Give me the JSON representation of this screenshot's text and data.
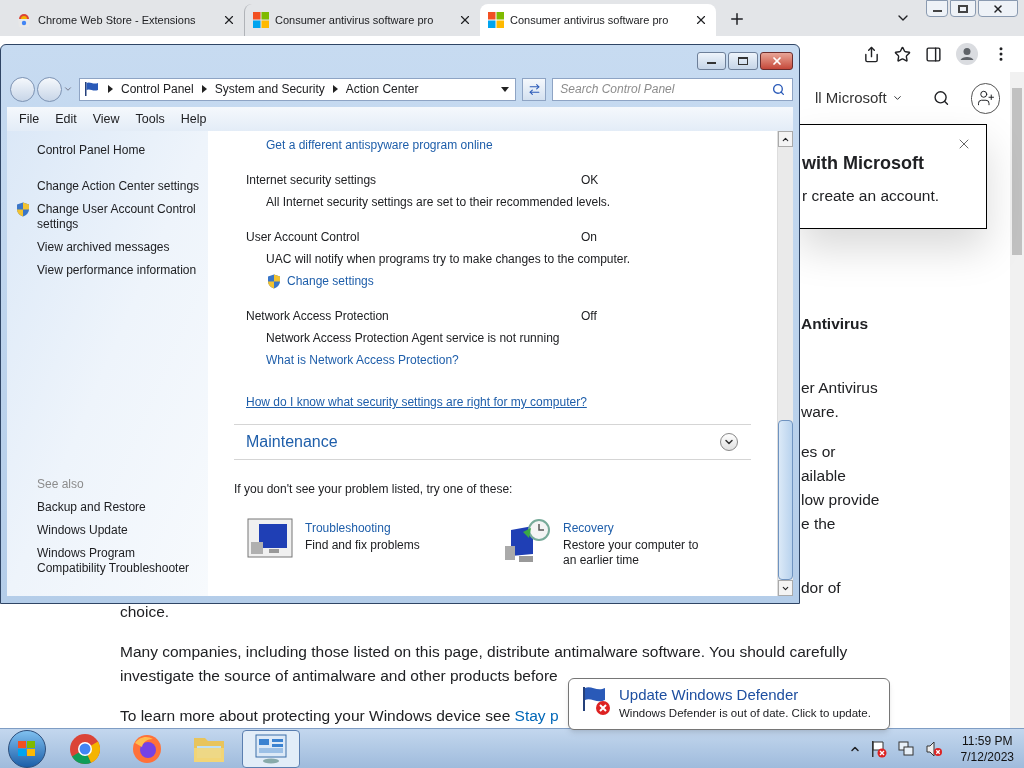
{
  "browser": {
    "tabs": [
      {
        "title": "Chrome Web Store - Extensions",
        "kind": "store",
        "selected": false
      },
      {
        "title": "Consumer antivirus software pro",
        "kind": "microsoft",
        "selected": false
      },
      {
        "title": "Consumer antivirus software pro",
        "kind": "microsoft",
        "selected": true
      }
    ],
    "page": {
      "nav_link": "ll Microsoft",
      "signin_popup": {
        "title": "with Microsoft",
        "text": "r create an account."
      },
      "heading": "Antivirus",
      "right_paragraphs": [
        [
          "er Antivirus",
          "ware."
        ],
        [
          "es or",
          "ailable",
          "low provide",
          "e the"
        ],
        [
          "dor of"
        ]
      ],
      "paragraphs": [
        [
          "choice."
        ],
        [
          "Many companies, including those listed on this page, distribute antimalware software. You should carefully",
          "investigate the source of antimalware and other products before"
        ],
        [
          "To learn more about protecting your Windows device see"
        ]
      ],
      "link": "Stay p"
    }
  },
  "control_panel": {
    "breadcrumb": [
      "Control Panel",
      "System and Security",
      "Action Center"
    ],
    "search_placeholder": "Search Control Panel",
    "menu": [
      "File",
      "Edit",
      "View",
      "Tools",
      "Help"
    ],
    "sidebar": {
      "links": [
        {
          "label": "Control Panel Home",
          "shield": false
        },
        {
          "label": "Change Action Center settings",
          "shield": false
        },
        {
          "label": "Change User Account Control settings",
          "shield": true
        },
        {
          "label": "View archived messages",
          "shield": false
        },
        {
          "label": "View performance information",
          "shield": false
        }
      ],
      "see_also_title": "See also",
      "see_also": [
        "Backup and Restore",
        "Windows Update",
        "Windows Program Compatibility Troubleshooter"
      ]
    },
    "top_link": "Get a different antispyware program online",
    "items": [
      {
        "name": "Internet security settings",
        "status": "OK",
        "description": "All Internet security settings are set to their recommended levels."
      },
      {
        "name": "User Account Control",
        "status": "On",
        "description": "UAC will notify when programs try to make changes to the computer.",
        "links": [
          {
            "label": "Change settings",
            "shield": true
          }
        ]
      },
      {
        "name": "Network Access Protection",
        "status": "Off",
        "description": "Network Access Protection Agent service is not running",
        "links": [
          {
            "label": "What is Network Access Protection?",
            "shield": false
          }
        ]
      }
    ],
    "help_link": "How do I know what security settings are right for my computer?",
    "maintenance": {
      "title": "Maintenance",
      "expanded": false
    },
    "prompt": "If you don't see your problem listed, try one of these:",
    "tools": [
      {
        "kind": "troubleshooting",
        "title": "Troubleshooting",
        "description": "Find and fix problems"
      },
      {
        "kind": "recovery",
        "title": "Recovery",
        "description": "Restore your computer to an earlier time"
      }
    ]
  },
  "notification": {
    "title": "Update Windows Defender",
    "message": "Windows Defender is out of date. Click to update."
  },
  "taskbar": {
    "apps": [
      {
        "kind": "chrome",
        "selected": false
      },
      {
        "kind": "firefox",
        "selected": false
      },
      {
        "kind": "explorer",
        "selected": false
      },
      {
        "kind": "controlpanel",
        "selected": true
      }
    ],
    "clock": {
      "time": "11:59 PM",
      "date": "7/12/2023"
    }
  }
}
